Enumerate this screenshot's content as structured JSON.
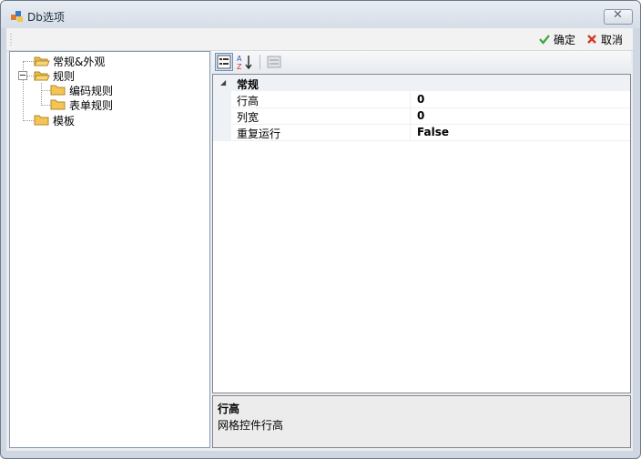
{
  "window": {
    "title": "Db选项"
  },
  "toolbar": {
    "ok_label": "确定",
    "cancel_label": "取消"
  },
  "tree": {
    "items": [
      {
        "label": "常规&外观"
      },
      {
        "label": "规则"
      },
      {
        "label": "编码规则"
      },
      {
        "label": "表单规则"
      },
      {
        "label": "模板"
      }
    ]
  },
  "property_grid": {
    "category": "常规",
    "rows": [
      {
        "name": "行高",
        "value": "0"
      },
      {
        "name": "列宽",
        "value": "0"
      },
      {
        "name": "重复运行",
        "value": "False"
      }
    ]
  },
  "description": {
    "title": "行高",
    "text": "网格控件行高"
  },
  "colors": {
    "accent": "#f3c555",
    "border": "#7f9db9",
    "ok_green": "#3aa63a",
    "cancel_red": "#d23b2b"
  },
  "icons": [
    "app-icon",
    "close-icon",
    "checkmark-icon",
    "x-icon",
    "folder-icon",
    "folder-open-icon",
    "categorized-icon",
    "alphabetical-sort-icon",
    "property-pages-icon"
  ]
}
